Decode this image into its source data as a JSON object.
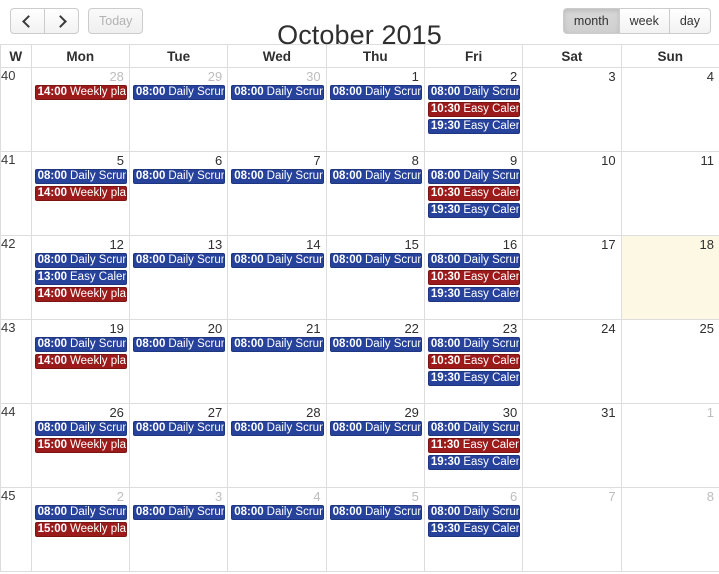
{
  "toolbar": {
    "prev_label": "",
    "next_label": "",
    "prev_icon": "chevron-left-icon",
    "next_icon": "chevron-right-icon",
    "today_label": "Today",
    "views": [
      {
        "key": "month",
        "label": "month",
        "active": true
      },
      {
        "key": "week",
        "label": "week",
        "active": false
      },
      {
        "key": "day",
        "label": "day",
        "active": false
      }
    ]
  },
  "title": "October 2015",
  "colors": {
    "event_blue": "#27429b",
    "event_red": "#9b1b1b",
    "today_background": "#fcf8e3",
    "grid_border": "#dddddd",
    "other_month_text": "#bdbdbd"
  },
  "columns": [
    "W",
    "Mon",
    "Tue",
    "Wed",
    "Thu",
    "Fri",
    "Sat",
    "Sun"
  ],
  "weeks": [
    {
      "number": "40",
      "days": [
        {
          "num": "28",
          "other": true,
          "today": false,
          "events": [
            {
              "time": "14:00",
              "title": "Weekly plan",
              "color": "red"
            }
          ]
        },
        {
          "num": "29",
          "other": true,
          "today": false,
          "events": [
            {
              "time": "08:00",
              "title": "Daily Scrum",
              "color": "blue"
            }
          ]
        },
        {
          "num": "30",
          "other": true,
          "today": false,
          "events": [
            {
              "time": "08:00",
              "title": "Daily Scrum",
              "color": "blue"
            }
          ]
        },
        {
          "num": "1",
          "other": false,
          "today": false,
          "events": [
            {
              "time": "08:00",
              "title": "Daily Scrum",
              "color": "blue"
            }
          ]
        },
        {
          "num": "2",
          "other": false,
          "today": false,
          "events": [
            {
              "time": "08:00",
              "title": "Daily Scrum",
              "color": "blue"
            },
            {
              "time": "10:30",
              "title": "Easy Calenc",
              "color": "red"
            },
            {
              "time": "19:30",
              "title": "Easy Calenc",
              "color": "blue"
            }
          ]
        },
        {
          "num": "3",
          "other": false,
          "today": false,
          "events": []
        },
        {
          "num": "4",
          "other": false,
          "today": false,
          "events": []
        }
      ]
    },
    {
      "number": "41",
      "days": [
        {
          "num": "5",
          "other": false,
          "today": false,
          "events": [
            {
              "time": "08:00",
              "title": "Daily Scrum",
              "color": "blue"
            },
            {
              "time": "14:00",
              "title": "Weekly plan",
              "color": "red"
            }
          ]
        },
        {
          "num": "6",
          "other": false,
          "today": false,
          "events": [
            {
              "time": "08:00",
              "title": "Daily Scrum",
              "color": "blue"
            }
          ]
        },
        {
          "num": "7",
          "other": false,
          "today": false,
          "events": [
            {
              "time": "08:00",
              "title": "Daily Scrum",
              "color": "blue"
            }
          ]
        },
        {
          "num": "8",
          "other": false,
          "today": false,
          "events": [
            {
              "time": "08:00",
              "title": "Daily Scrum",
              "color": "blue"
            }
          ]
        },
        {
          "num": "9",
          "other": false,
          "today": false,
          "events": [
            {
              "time": "08:00",
              "title": "Daily Scrum",
              "color": "blue"
            },
            {
              "time": "10:30",
              "title": "Easy Calenc",
              "color": "red"
            },
            {
              "time": "19:30",
              "title": "Easy Calenc",
              "color": "blue"
            }
          ]
        },
        {
          "num": "10",
          "other": false,
          "today": false,
          "events": []
        },
        {
          "num": "11",
          "other": false,
          "today": false,
          "events": []
        }
      ]
    },
    {
      "number": "42",
      "days": [
        {
          "num": "12",
          "other": false,
          "today": false,
          "events": [
            {
              "time": "08:00",
              "title": "Daily Scrum",
              "color": "blue"
            },
            {
              "time": "13:00",
              "title": "Easy Calenc",
              "color": "blue"
            },
            {
              "time": "14:00",
              "title": "Weekly plan",
              "color": "red"
            }
          ]
        },
        {
          "num": "13",
          "other": false,
          "today": false,
          "events": [
            {
              "time": "08:00",
              "title": "Daily Scrum",
              "color": "blue"
            }
          ]
        },
        {
          "num": "14",
          "other": false,
          "today": false,
          "events": [
            {
              "time": "08:00",
              "title": "Daily Scrum",
              "color": "blue"
            }
          ]
        },
        {
          "num": "15",
          "other": false,
          "today": false,
          "events": [
            {
              "time": "08:00",
              "title": "Daily Scrum",
              "color": "blue"
            }
          ]
        },
        {
          "num": "16",
          "other": false,
          "today": false,
          "events": [
            {
              "time": "08:00",
              "title": "Daily Scrum",
              "color": "blue"
            },
            {
              "time": "10:30",
              "title": "Easy Calenc",
              "color": "red"
            },
            {
              "time": "19:30",
              "title": "Easy Calenc",
              "color": "blue"
            }
          ]
        },
        {
          "num": "17",
          "other": false,
          "today": false,
          "events": []
        },
        {
          "num": "18",
          "other": false,
          "today": true,
          "events": []
        }
      ]
    },
    {
      "number": "43",
      "days": [
        {
          "num": "19",
          "other": false,
          "today": false,
          "events": [
            {
              "time": "08:00",
              "title": "Daily Scrum",
              "color": "blue"
            },
            {
              "time": "14:00",
              "title": "Weekly plan",
              "color": "red"
            }
          ]
        },
        {
          "num": "20",
          "other": false,
          "today": false,
          "events": [
            {
              "time": "08:00",
              "title": "Daily Scrum",
              "color": "blue"
            }
          ]
        },
        {
          "num": "21",
          "other": false,
          "today": false,
          "events": [
            {
              "time": "08:00",
              "title": "Daily Scrum",
              "color": "blue"
            }
          ]
        },
        {
          "num": "22",
          "other": false,
          "today": false,
          "events": [
            {
              "time": "08:00",
              "title": "Daily Scrum",
              "color": "blue"
            }
          ]
        },
        {
          "num": "23",
          "other": false,
          "today": false,
          "events": [
            {
              "time": "08:00",
              "title": "Daily Scrum",
              "color": "blue"
            },
            {
              "time": "10:30",
              "title": "Easy Calenc",
              "color": "red"
            },
            {
              "time": "19:30",
              "title": "Easy Calenc",
              "color": "blue"
            }
          ]
        },
        {
          "num": "24",
          "other": false,
          "today": false,
          "events": []
        },
        {
          "num": "25",
          "other": false,
          "today": false,
          "events": []
        }
      ]
    },
    {
      "number": "44",
      "days": [
        {
          "num": "26",
          "other": false,
          "today": false,
          "events": [
            {
              "time": "08:00",
              "title": "Daily Scrum",
              "color": "blue"
            },
            {
              "time": "15:00",
              "title": "Weekly plan",
              "color": "red"
            }
          ]
        },
        {
          "num": "27",
          "other": false,
          "today": false,
          "events": [
            {
              "time": "08:00",
              "title": "Daily Scrum",
              "color": "blue"
            }
          ]
        },
        {
          "num": "28",
          "other": false,
          "today": false,
          "events": [
            {
              "time": "08:00",
              "title": "Daily Scrum",
              "color": "blue"
            }
          ]
        },
        {
          "num": "29",
          "other": false,
          "today": false,
          "events": [
            {
              "time": "08:00",
              "title": "Daily Scrum",
              "color": "blue"
            }
          ]
        },
        {
          "num": "30",
          "other": false,
          "today": false,
          "events": [
            {
              "time": "08:00",
              "title": "Daily Scrum",
              "color": "blue"
            },
            {
              "time": "11:30",
              "title": "Easy Calend",
              "color": "red"
            },
            {
              "time": "19:30",
              "title": "Easy Calenc",
              "color": "blue"
            }
          ]
        },
        {
          "num": "31",
          "other": false,
          "today": false,
          "events": []
        },
        {
          "num": "1",
          "other": true,
          "today": false,
          "events": []
        }
      ]
    },
    {
      "number": "45",
      "days": [
        {
          "num": "2",
          "other": true,
          "today": false,
          "events": [
            {
              "time": "08:00",
              "title": "Daily Scrum",
              "color": "blue"
            },
            {
              "time": "15:00",
              "title": "Weekly plan",
              "color": "red"
            }
          ]
        },
        {
          "num": "3",
          "other": true,
          "today": false,
          "events": [
            {
              "time": "08:00",
              "title": "Daily Scrum",
              "color": "blue"
            }
          ]
        },
        {
          "num": "4",
          "other": true,
          "today": false,
          "events": [
            {
              "time": "08:00",
              "title": "Daily Scrum",
              "color": "blue"
            }
          ]
        },
        {
          "num": "5",
          "other": true,
          "today": false,
          "events": [
            {
              "time": "08:00",
              "title": "Daily Scrum",
              "color": "blue"
            }
          ]
        },
        {
          "num": "6",
          "other": true,
          "today": false,
          "events": [
            {
              "time": "08:00",
              "title": "Daily Scrum",
              "color": "blue"
            },
            {
              "time": "19:30",
              "title": "Easy Calenc",
              "color": "blue"
            }
          ]
        },
        {
          "num": "7",
          "other": true,
          "today": false,
          "events": []
        },
        {
          "num": "8",
          "other": true,
          "today": false,
          "events": []
        }
      ]
    }
  ]
}
